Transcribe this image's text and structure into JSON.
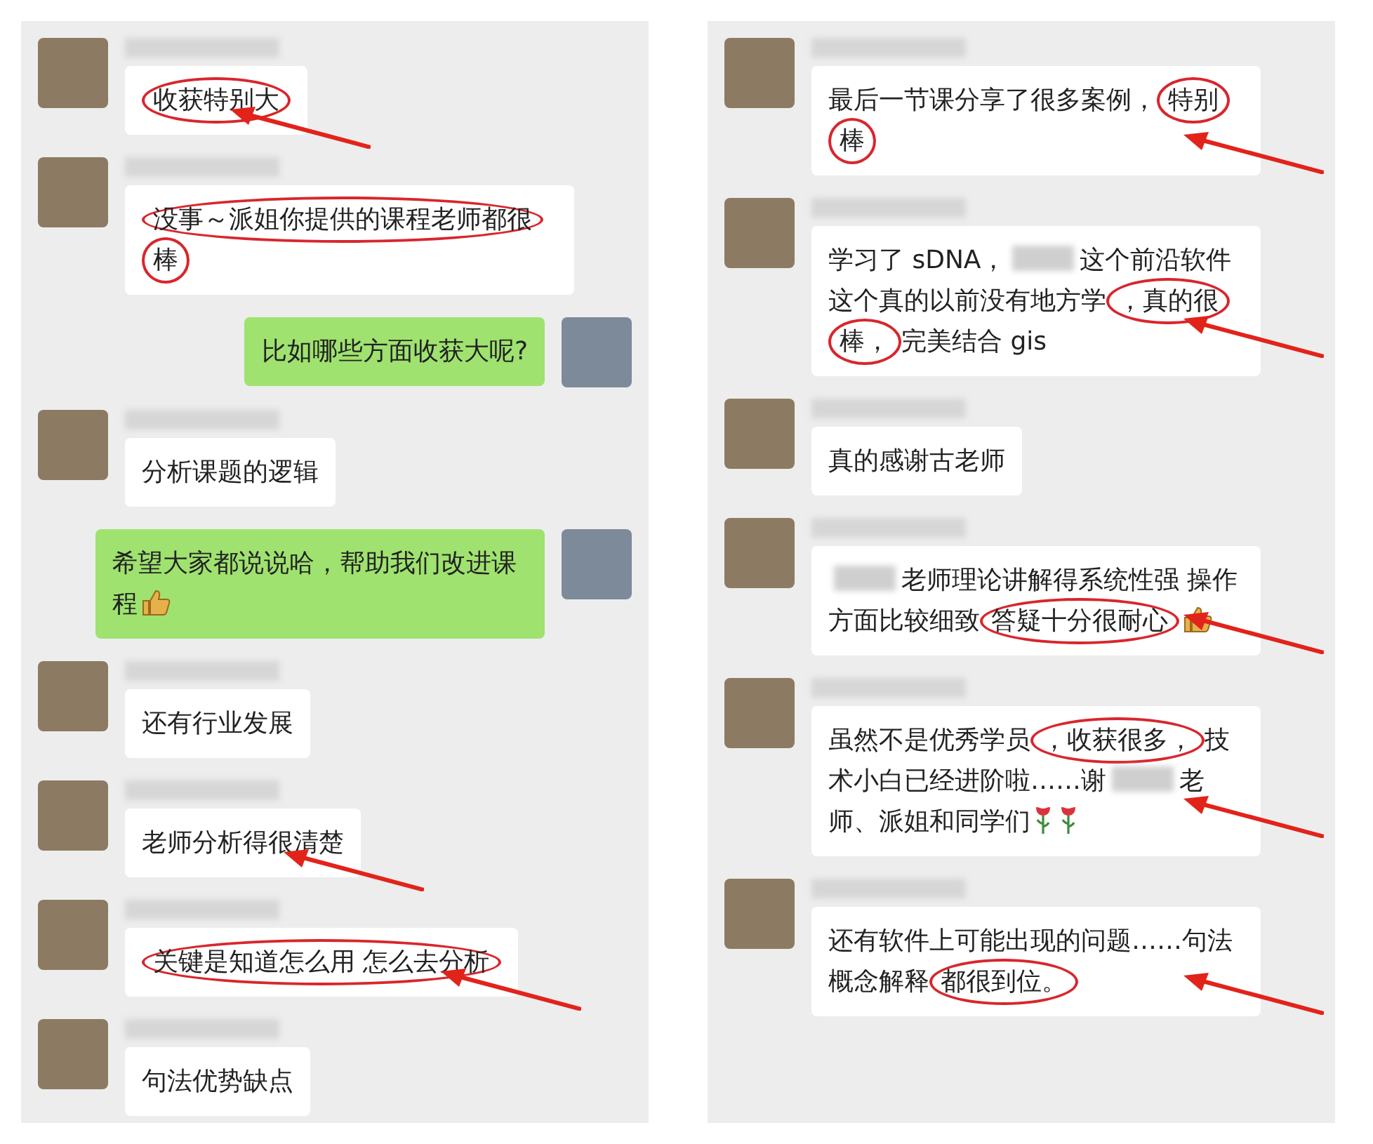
{
  "panels": [
    {
      "messages": [
        {
          "kind": "incoming",
          "arrow": true,
          "segments": [
            {
              "kind": "text",
              "text": "收获特别大",
              "circled": true
            }
          ]
        },
        {
          "kind": "incoming",
          "arrow": false,
          "segments": [
            {
              "kind": "text",
              "text": "没事～派姐你提供的课程老师都很棒",
              "circled": true
            }
          ]
        },
        {
          "kind": "outgoing",
          "arrow": false,
          "segments": [
            {
              "kind": "text",
              "text": "比如哪些方面收获大呢?",
              "circled": false
            }
          ]
        },
        {
          "kind": "incoming",
          "arrow": false,
          "segments": [
            {
              "kind": "text",
              "text": "分析课题的逻辑",
              "circled": false
            }
          ]
        },
        {
          "kind": "outgoing",
          "arrow": false,
          "segments": [
            {
              "kind": "text",
              "text": "希望大家都说说哈，帮助我们改进课程",
              "circled": false
            },
            {
              "kind": "thumbs-up",
              "circled": false
            }
          ]
        },
        {
          "kind": "incoming",
          "arrow": false,
          "segments": [
            {
              "kind": "text",
              "text": "还有行业发展",
              "circled": false
            }
          ]
        },
        {
          "kind": "incoming",
          "arrow": true,
          "segments": [
            {
              "kind": "text",
              "text": "老师分析得很清楚",
              "circled": false
            }
          ]
        },
        {
          "kind": "incoming",
          "arrow": true,
          "segments": [
            {
              "kind": "text",
              "text": "关键是知道怎么用 怎么去分析",
              "circled": true
            }
          ]
        },
        {
          "kind": "incoming",
          "arrow": false,
          "segments": [
            {
              "kind": "text",
              "text": "句法优势缺点",
              "circled": false
            }
          ]
        }
      ]
    },
    {
      "messages": [
        {
          "kind": "incoming",
          "arrow": true,
          "segments": [
            {
              "kind": "text",
              "text": "最后一节课分享了很多案例，",
              "circled": false
            },
            {
              "kind": "text",
              "text": "特别棒",
              "circled": true
            }
          ]
        },
        {
          "kind": "incoming",
          "arrow": true,
          "segments": [
            {
              "kind": "text",
              "text": "学习了 sDNA，",
              "circled": false
            },
            {
              "kind": "redacted",
              "circled": false
            },
            {
              "kind": "text",
              "text": "这个前沿软件这个真的以前没有地方学",
              "circled": false
            },
            {
              "kind": "text",
              "text": "，真的很棒，",
              "circled": true
            },
            {
              "kind": "text",
              "text": "完美结合 gis",
              "circled": false
            }
          ]
        },
        {
          "kind": "incoming",
          "arrow": false,
          "segments": [
            {
              "kind": "text",
              "text": "真的感谢古老师",
              "circled": false
            }
          ]
        },
        {
          "kind": "incoming",
          "arrow": true,
          "segments": [
            {
              "kind": "redacted",
              "circled": false
            },
            {
              "kind": "text",
              "text": "老师理论讲解得系统性强 操作方面比较细致",
              "circled": false
            },
            {
              "kind": "text",
              "text": "答疑十分很耐心",
              "circled": true
            },
            {
              "kind": "thumbs-up",
              "circled": false
            }
          ]
        },
        {
          "kind": "incoming",
          "arrow": true,
          "segments": [
            {
              "kind": "text",
              "text": "虽然不是优秀学员",
              "circled": false
            },
            {
              "kind": "text",
              "text": "，收获很多，",
              "circled": true
            },
            {
              "kind": "text",
              "text": "技术小白已经进阶啦……谢",
              "circled": false
            },
            {
              "kind": "redacted",
              "circled": false
            },
            {
              "kind": "text",
              "text": "老师、派姐和同学们",
              "circled": false
            },
            {
              "kind": "rose",
              "circled": false
            },
            {
              "kind": "rose",
              "circled": false
            }
          ]
        },
        {
          "kind": "incoming",
          "arrow": true,
          "segments": [
            {
              "kind": "text",
              "text": "还有软件上可能出现的问题……句法概念解释",
              "circled": false
            },
            {
              "kind": "text",
              "text": "都很到位。",
              "circled": true
            }
          ]
        }
      ]
    }
  ]
}
